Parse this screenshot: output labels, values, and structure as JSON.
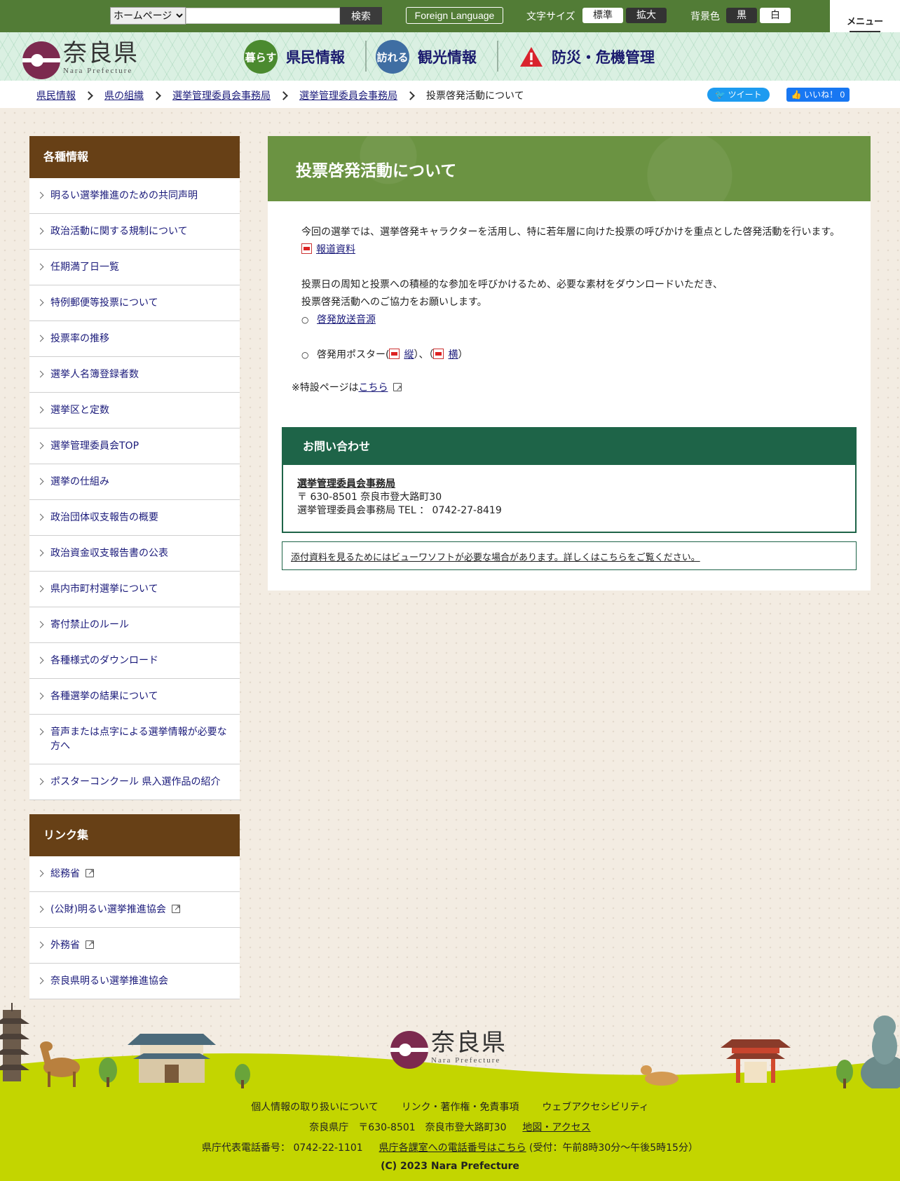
{
  "topbar": {
    "site_select": "ホームページ",
    "search_button": "検索",
    "foreign_language": "Foreign Language",
    "font_size_label": "文字サイズ",
    "font_standard": "標準",
    "font_large": "拡大",
    "bg_label": "背景色",
    "bg_black": "黒",
    "bg_white": "白",
    "menu": "メニュー"
  },
  "header": {
    "logo_jp": "奈良県",
    "logo_en": "Nara Prefecture",
    "nav": [
      {
        "badge": "暮らす",
        "label": "県民情報"
      },
      {
        "badge": "訪れる",
        "label": "観光情報"
      },
      {
        "label": "防災・危機管理"
      }
    ]
  },
  "breadcrumb": {
    "items": [
      "県民情報",
      "県の組織",
      "選挙管理委員会事務局",
      "選挙管理委員会事務局"
    ],
    "current": "投票啓発活動について",
    "tweet": "ツイート",
    "like": "いいね！ 0"
  },
  "sidebar": {
    "section1_title": "各種情報",
    "section1_items": [
      "明るい選挙推進のための共同声明",
      "政治活動に関する規制について",
      "任期満了日一覧",
      "特例郵便等投票について",
      "投票率の推移",
      "選挙人名簿登録者数",
      "選挙区と定数",
      "選挙管理委員会TOP",
      "選挙の仕組み",
      "政治団体収支報告の概要",
      "政治資金収支報告書の公表",
      "県内市町村選挙について",
      "寄付禁止のルール",
      "各種様式のダウンロード",
      "各種選挙の結果について",
      "音声または点字による選挙情報が必要な方へ",
      "ポスターコンクール 県入選作品の紹介"
    ],
    "section2_title": "リンク集",
    "section2_items": [
      "総務省",
      "(公財)明るい選挙推進協会",
      "外務省",
      "奈良県明るい選挙推進協会"
    ]
  },
  "main": {
    "title": "投票啓発活動について",
    "intro": "今回の選挙では、選挙啓発キャラクターを活用し、特に若年層に向けた投票の呼びかけを重点とした啓発活動を行います。",
    "press_link": "報道資料",
    "para1": "投票日の周知と投票への積極的な参加を呼びかけるため、必要な素材をダウンロードいただき、",
    "para2": "投票啓発活動へのご協力をお願いします。",
    "audio_link": "啓発放送音源",
    "poster_prefix": "啓発用ポスター(",
    "poster_vertical": "縦",
    "poster_mid": "）、（",
    "poster_horizontal": "横",
    "poster_suffix": "）",
    "special_prefix": "※特設ページは",
    "special_link": "こちら",
    "contact_title": "お問い合わせ",
    "contact_dept": "選挙管理委員会事務局",
    "contact_address": "〒 630-8501 奈良市登大路町30",
    "contact_tel": "選挙管理委員会事務局 TEL ： 0742-27-8419",
    "viewer_note": "添付資料を見るためにはビューワソフトが必要な場合があります。詳しくはこちらをご覧ください。"
  },
  "footer": {
    "logo_jp": "奈良県",
    "logo_en": "Nara Prefecture",
    "links": [
      "個人情報の取り扱いについて",
      "リンク・著作権・免責事項",
      "ウェブアクセシビリティ"
    ],
    "office": "奈良県庁　〒630-8501　奈良市登大路町30",
    "map_link": "地図・アクセス",
    "phone": "県庁代表電話番号： 0742-22-1101",
    "phone_link": "県庁各課室への電話番号はこちら",
    "hours": "(受付：午前8時30分～午後5時15分）",
    "copyright": "(C) 2023 Nara Prefecture"
  },
  "colors": {
    "topbar": "#527c36",
    "sidebar_head": "#674016",
    "title_band": "#6b9342",
    "contact": "#1e6448",
    "footer": "#c3d500"
  }
}
